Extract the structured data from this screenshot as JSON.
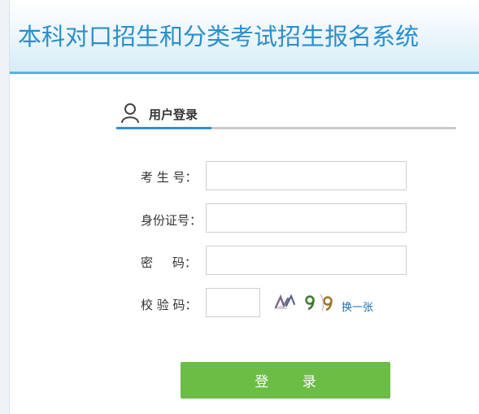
{
  "header": {
    "title": "本科对口招生和分类考试招生报名系统"
  },
  "login_panel": {
    "heading": "用户登录"
  },
  "form": {
    "exam_no_label": "考 生 号：",
    "id_card_label": "身份证号：",
    "password_label": "密     码：",
    "captcha_label": "校 验 码：",
    "exam_no_value": "",
    "id_card_value": "",
    "password_value": "",
    "captcha_value": ""
  },
  "captcha": {
    "refresh_label": "换一张"
  },
  "submit": {
    "label": "登 录"
  },
  "colors": {
    "title": "#2a8fcb",
    "header_border": "#5ab0de",
    "tab_underline_active": "#2f8fd0",
    "button": "#6bbd46",
    "link": "#1c6fb5"
  },
  "icons": {
    "login_heading_icon": "user-icon"
  }
}
